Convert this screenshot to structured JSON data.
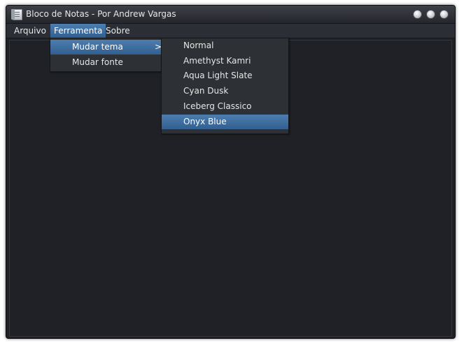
{
  "window": {
    "title": "Bloco de Notas - Por Andrew Vargas",
    "controls": [
      "minimize",
      "maximize",
      "close"
    ]
  },
  "menubar": {
    "items": [
      {
        "label": "Arquivo",
        "active": false
      },
      {
        "label": "Ferramenta",
        "active": true
      },
      {
        "label": "Sobre",
        "active": false
      }
    ]
  },
  "ferramenta_menu": {
    "items": [
      {
        "label": "Mudar tema",
        "has_submenu": true,
        "active": true,
        "submenu_indicator": ">"
      },
      {
        "label": "Mudar fonte",
        "has_submenu": false,
        "active": false
      }
    ]
  },
  "tema_submenu": {
    "items": [
      {
        "label": "Normal",
        "active": false
      },
      {
        "label": "Amethyst Kamri",
        "active": false
      },
      {
        "label": "Aqua Light Slate",
        "active": false
      },
      {
        "label": "Cyan Dusk",
        "active": false
      },
      {
        "label": "Iceberg Classico",
        "active": false
      },
      {
        "label": "Onyx Blue",
        "active": true
      }
    ]
  },
  "editor": {
    "content": ""
  },
  "colors": {
    "background": "#1f2126",
    "menubar": "#2b2e34",
    "highlight": "#3f6f9f",
    "text": "#e6e6e6"
  },
  "icons": {
    "app": "notepad-icon",
    "submenu": "chevron-right-icon"
  }
}
